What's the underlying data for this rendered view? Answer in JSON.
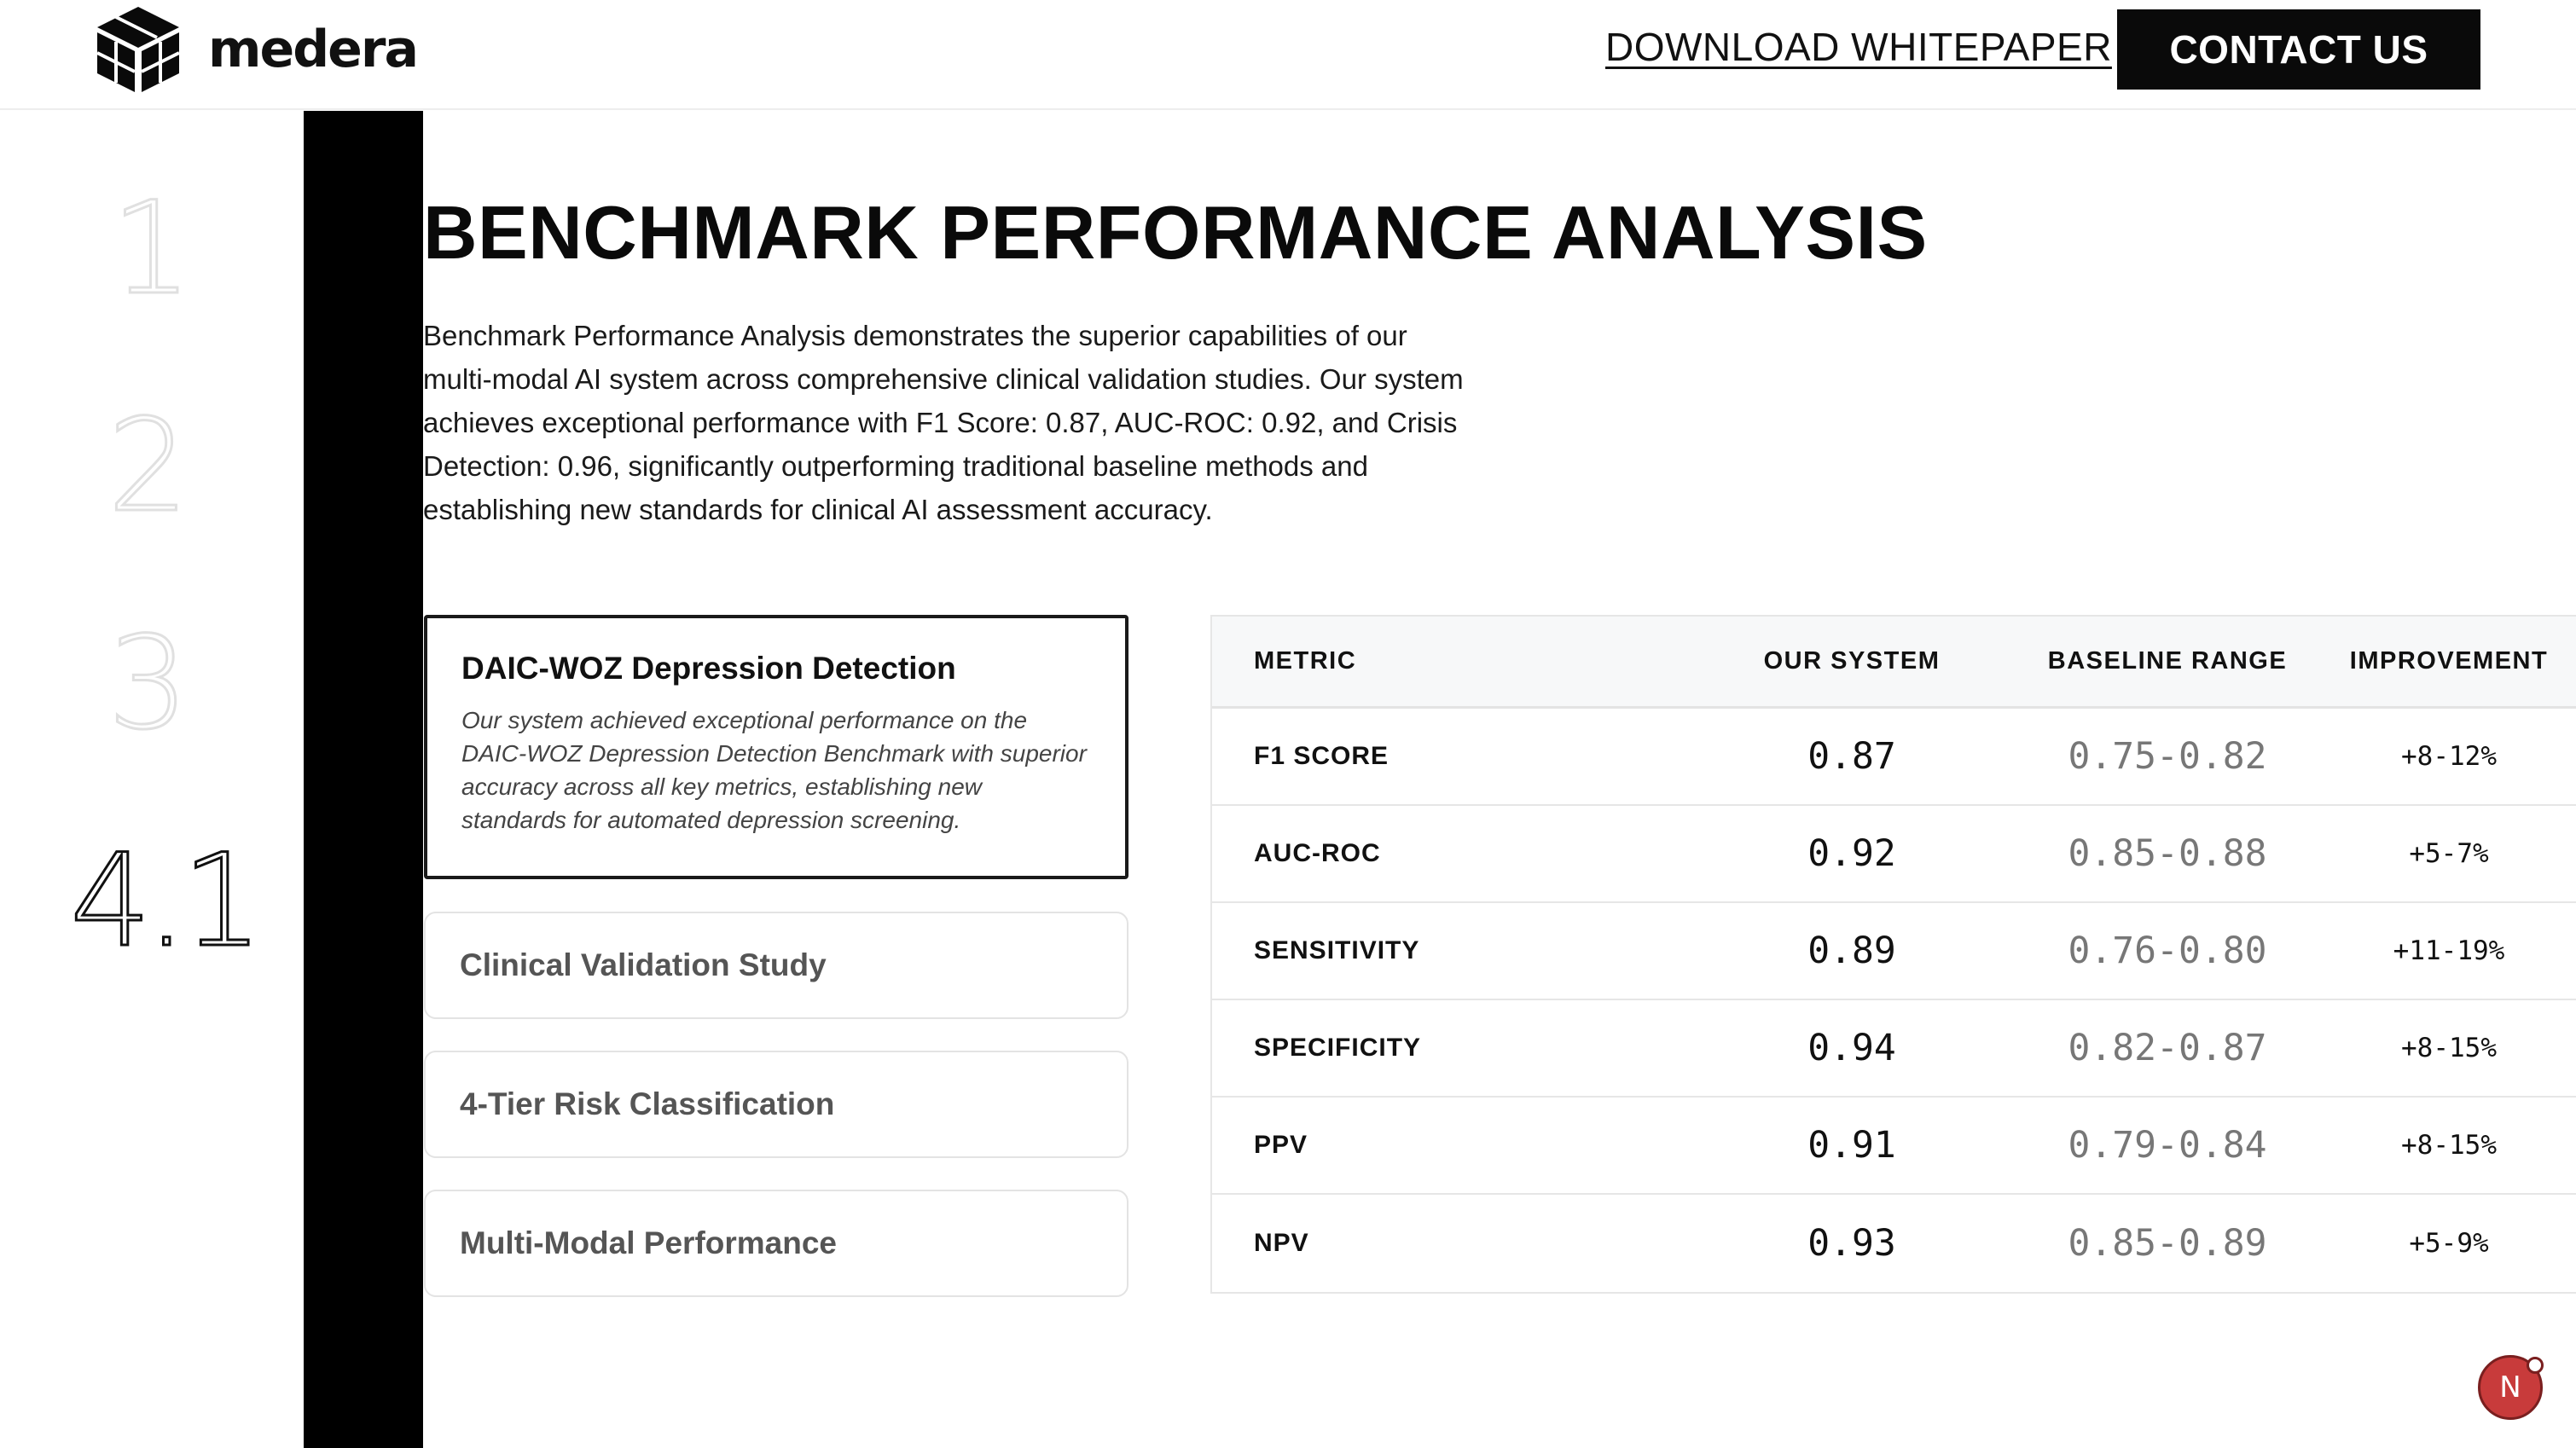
{
  "header": {
    "logo_text": "medera",
    "download_label": "DOWNLOAD WHITEPAPER",
    "contact_label": "CONTACT US"
  },
  "steps": [
    "1",
    "2",
    "3",
    "4.1"
  ],
  "main": {
    "title": "BENCHMARK PERFORMANCE ANALYSIS",
    "intro": "Benchmark Performance Analysis demonstrates the superior capabilities of our multi-modal AI system across comprehensive clinical validation studies. Our system achieves exceptional performance with F1 Score: 0.87, AUC-ROC: 0.92, and Crisis Detection: 0.96, significantly outperforming traditional baseline methods and establishing new standards for clinical AI assessment accuracy."
  },
  "cards": {
    "active": {
      "title": "DAIC-WOZ Depression Detection",
      "description": "Our system achieved exceptional performance on the DAIC-WOZ Depression Detection Benchmark with superior accuracy across all key metrics, establishing new standards for automated depression screening."
    },
    "items": [
      {
        "title": "Clinical Validation Study"
      },
      {
        "title": "4-Tier Risk Classification"
      },
      {
        "title": "Multi-Modal Performance"
      }
    ]
  },
  "table": {
    "headers": [
      "METRIC",
      "OUR SYSTEM",
      "BASELINE RANGE",
      "IMPROVEMENT"
    ],
    "rows": [
      {
        "metric": "F1 SCORE",
        "our": "0.87",
        "baseline": "0.75-0.82",
        "improvement": "+8-12%"
      },
      {
        "metric": "AUC-ROC",
        "our": "0.92",
        "baseline": "0.85-0.88",
        "improvement": "+5-7%"
      },
      {
        "metric": "SENSITIVITY",
        "our": "0.89",
        "baseline": "0.76-0.80",
        "improvement": "+11-19%"
      },
      {
        "metric": "SPECIFICITY",
        "our": "0.94",
        "baseline": "0.82-0.87",
        "improvement": "+8-15%"
      },
      {
        "metric": "PPV",
        "our": "0.91",
        "baseline": "0.79-0.84",
        "improvement": "+8-15%"
      },
      {
        "metric": "NPV",
        "our": "0.93",
        "baseline": "0.85-0.89",
        "improvement": "+5-9%"
      }
    ]
  },
  "avatar_letter": "N",
  "colors": {
    "accent_black": "#0a0a0a",
    "avatar_red": "#c83b3b"
  }
}
